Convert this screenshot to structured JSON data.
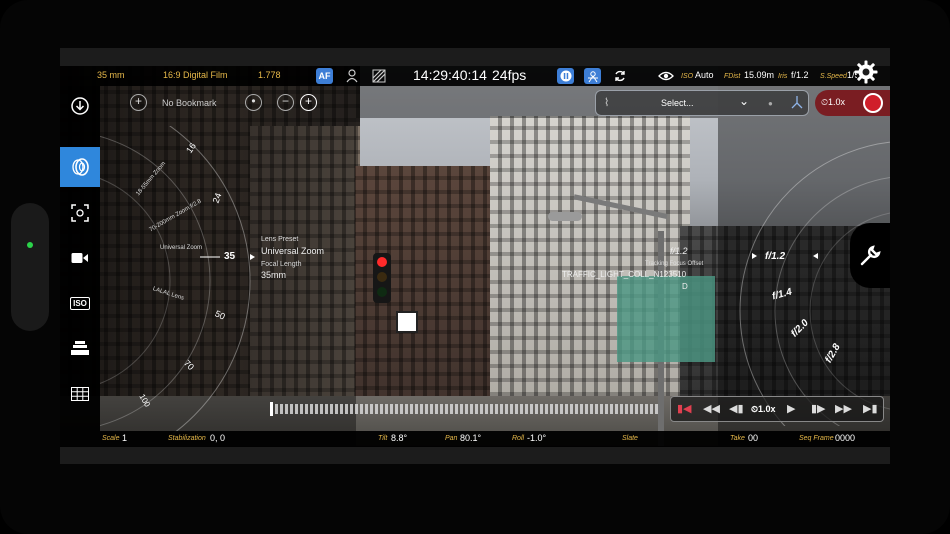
{
  "topbar": {
    "focal_length": "35 mm",
    "format": "16:9 Digital Film",
    "aspect": "1.778",
    "icons": [
      "af-icon",
      "operator-icon",
      "zebra-icon"
    ],
    "af_label": "AF",
    "time": "14:29:40:14",
    "fps": "24fps",
    "right_icons": [
      "pause-icon",
      "stabilizer-icon",
      "sync-icon"
    ],
    "iso_label": "ISO",
    "iso_value": "Auto",
    "fdist_label": "FDist",
    "fdist_value": "15.09m",
    "iris_label": "Iris",
    "iris_value": "f/1.2",
    "speed_label": "S.Speed",
    "speed_value": "1/50"
  },
  "bookmark": {
    "label": "No Bookmark",
    "buttons": [
      "zoom-in-icon",
      "stop-icon",
      "minus-icon",
      "add-icon"
    ]
  },
  "select": {
    "label": "Select..."
  },
  "record": {
    "zoom": "1.0x"
  },
  "sidebar": {
    "items": [
      {
        "name": "download-icon"
      },
      {
        "name": "lens-icon",
        "active": true
      },
      {
        "name": "focus-target-icon"
      },
      {
        "name": "video-camera-icon"
      },
      {
        "name": "iso-icon",
        "label": "ISO"
      },
      {
        "name": "filter-icon"
      },
      {
        "name": "grid-icon"
      }
    ]
  },
  "lens_wheel": {
    "preset_title": "Lens Preset",
    "preset_value": "Universal Zoom",
    "focal_title": "Focal Length",
    "focal_value": "35mm",
    "ring_label_1": "Universal Zoom",
    "ring_label_2": "LALAL Lens",
    "ring_label_3": "70-200mm Zoom f/2.8",
    "ring_label_4": "18-55mm Zoom",
    "ticks": [
      "16",
      "24",
      "35",
      "50",
      "70",
      "100"
    ],
    "current": "35"
  },
  "focus_wheel": {
    "overlay_value": "f/1.2",
    "overlay_sub": "Tracking Focus Offset",
    "object_label": "TRAFFIC_LIGHT_COLL_N123510",
    "object_sub": "D",
    "current": "f/1.2",
    "ticks": [
      "f/1.4",
      "f/2.0",
      "f/2.8"
    ]
  },
  "playback": {
    "speed": "1.0x"
  },
  "bottombar": {
    "scale_label": "Scale",
    "scale_value": "1",
    "stab_label": "Stabilization",
    "stab_value": "0, 0",
    "tilt_label": "Tilt",
    "tilt_value": "8.8°",
    "pan_label": "Pan",
    "pan_value": "80.1°",
    "roll_label": "Roll",
    "roll_value": "-1.0°",
    "slate_label": "Slate",
    "take_label": "Take",
    "take_value": "00",
    "seq_label": "Seq Frame",
    "seq_value": "0000"
  },
  "colors": {
    "accent": "#2f87dc",
    "label_gold": "#e7b94a",
    "record_red": "#d01e2a",
    "status_green": "#2bd34a"
  }
}
